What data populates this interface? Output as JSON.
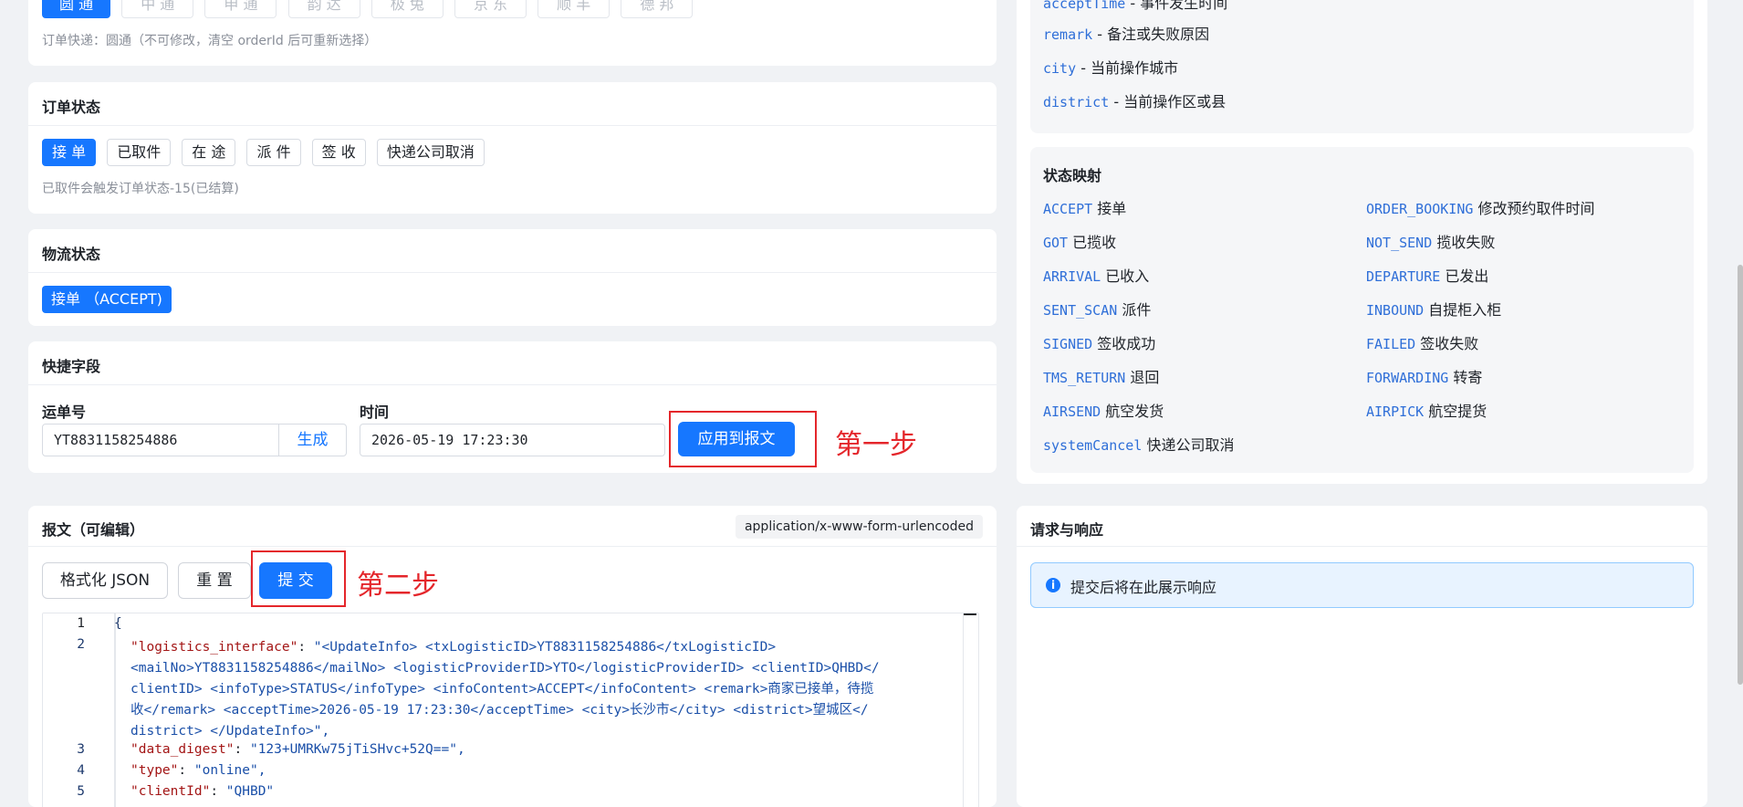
{
  "express": {
    "buttons": [
      "圆 通",
      "中 通",
      "申 通",
      "韵 达",
      "极 兔",
      "京 东",
      "顺 丰",
      "德 邦"
    ],
    "note": "订单快递：圆通（不可修改，清空 orderId 后可重新选择）"
  },
  "order_status": {
    "title": "订单状态",
    "buttons": [
      "接 单",
      "已取件",
      "在 途",
      "派 件",
      "签 收",
      "快递公司取消"
    ],
    "note": "已取件会触发订单状态-15(已结算)"
  },
  "logistics_status": {
    "title": "物流状态",
    "selected": "接单 （ACCEPT)"
  },
  "quick_fields": {
    "title": "快捷字段",
    "waybill_label": "运单号",
    "waybill_value": "YT8831158254886",
    "generate_label": "生成",
    "time_label": "时间",
    "time_value": "2026-05-19 17:23:30",
    "apply_label": "应用到报文",
    "step1": "第一步"
  },
  "field_docs": {
    "partial_top": "acceptTime - 事件发生时间",
    "items": [
      {
        "key": "remark",
        "desc": " - 备注或失败原因"
      },
      {
        "key": "city",
        "desc": " - 当前操作城市"
      },
      {
        "key": "district",
        "desc": " - 当前操作区或县"
      }
    ]
  },
  "status_map": {
    "title": "状态映射",
    "left": [
      {
        "code": "ACCEPT",
        "desc": " 接单"
      },
      {
        "code": "GOT",
        "desc": " 已揽收"
      },
      {
        "code": "ARRIVAL",
        "desc": " 已收入"
      },
      {
        "code": "SENT_SCAN",
        "desc": " 派件"
      },
      {
        "code": "SIGNED",
        "desc": " 签收成功"
      },
      {
        "code": "TMS_RETURN",
        "desc": " 退回"
      },
      {
        "code": "AIRSEND",
        "desc": " 航空发货"
      },
      {
        "code": "systemCancel",
        "desc": " 快递公司取消"
      }
    ],
    "right": [
      {
        "code": "ORDER_BOOKING",
        "desc": " 修改预约取件时间"
      },
      {
        "code": "NOT_SEND",
        "desc": " 揽收失败"
      },
      {
        "code": "DEPARTURE",
        "desc": " 已发出"
      },
      {
        "code": "INBOUND",
        "desc": " 自提柜入柜"
      },
      {
        "code": "FAILED",
        "desc": " 签收失败"
      },
      {
        "code": "FORWARDING",
        "desc": " 转寄"
      },
      {
        "code": "AIRPICK",
        "desc": " 航空提货"
      }
    ]
  },
  "payload": {
    "title": "报文（可编辑）",
    "content_type": "application/x-www-form-urlencoded",
    "format_label": "格式化 JSON",
    "reset_label": "重 置",
    "submit_label": "提 交",
    "step2": "第二步",
    "lines": [
      {
        "n": "1",
        "text": "{"
      },
      {
        "n": "2",
        "key": "\"logistics_interface\"",
        "val_lines": [
          "\"<UpdateInfo>   <txLogisticID>YT8831158254886</txLogisticID>",
          "<mailNo>YT8831158254886</mailNo>   <logisticProviderID>YTO</logisticProviderID>   <clientID>QHBD</",
          "clientID>   <infoType>STATUS</infoType>   <infoContent>ACCEPT</infoContent>   <remark>商家已接单，待揽",
          "收</remark>   <acceptTime>2026-05-19 17:23:30</acceptTime>   <city>长沙市</city>   <district>望城区</",
          "district> </UpdateInfo>\","
        ]
      },
      {
        "n": "3",
        "key": "\"data_digest\"",
        "val": "\"123+UMRKw75jTiSHvc+52Q==\","
      },
      {
        "n": "4",
        "key": "\"type\"",
        "val": "\"online\","
      },
      {
        "n": "5",
        "key": "\"clientId\"",
        "val": "\"QHBD\""
      }
    ]
  },
  "response": {
    "title": "请求与响应",
    "info": "提交后将在此展示响应"
  }
}
